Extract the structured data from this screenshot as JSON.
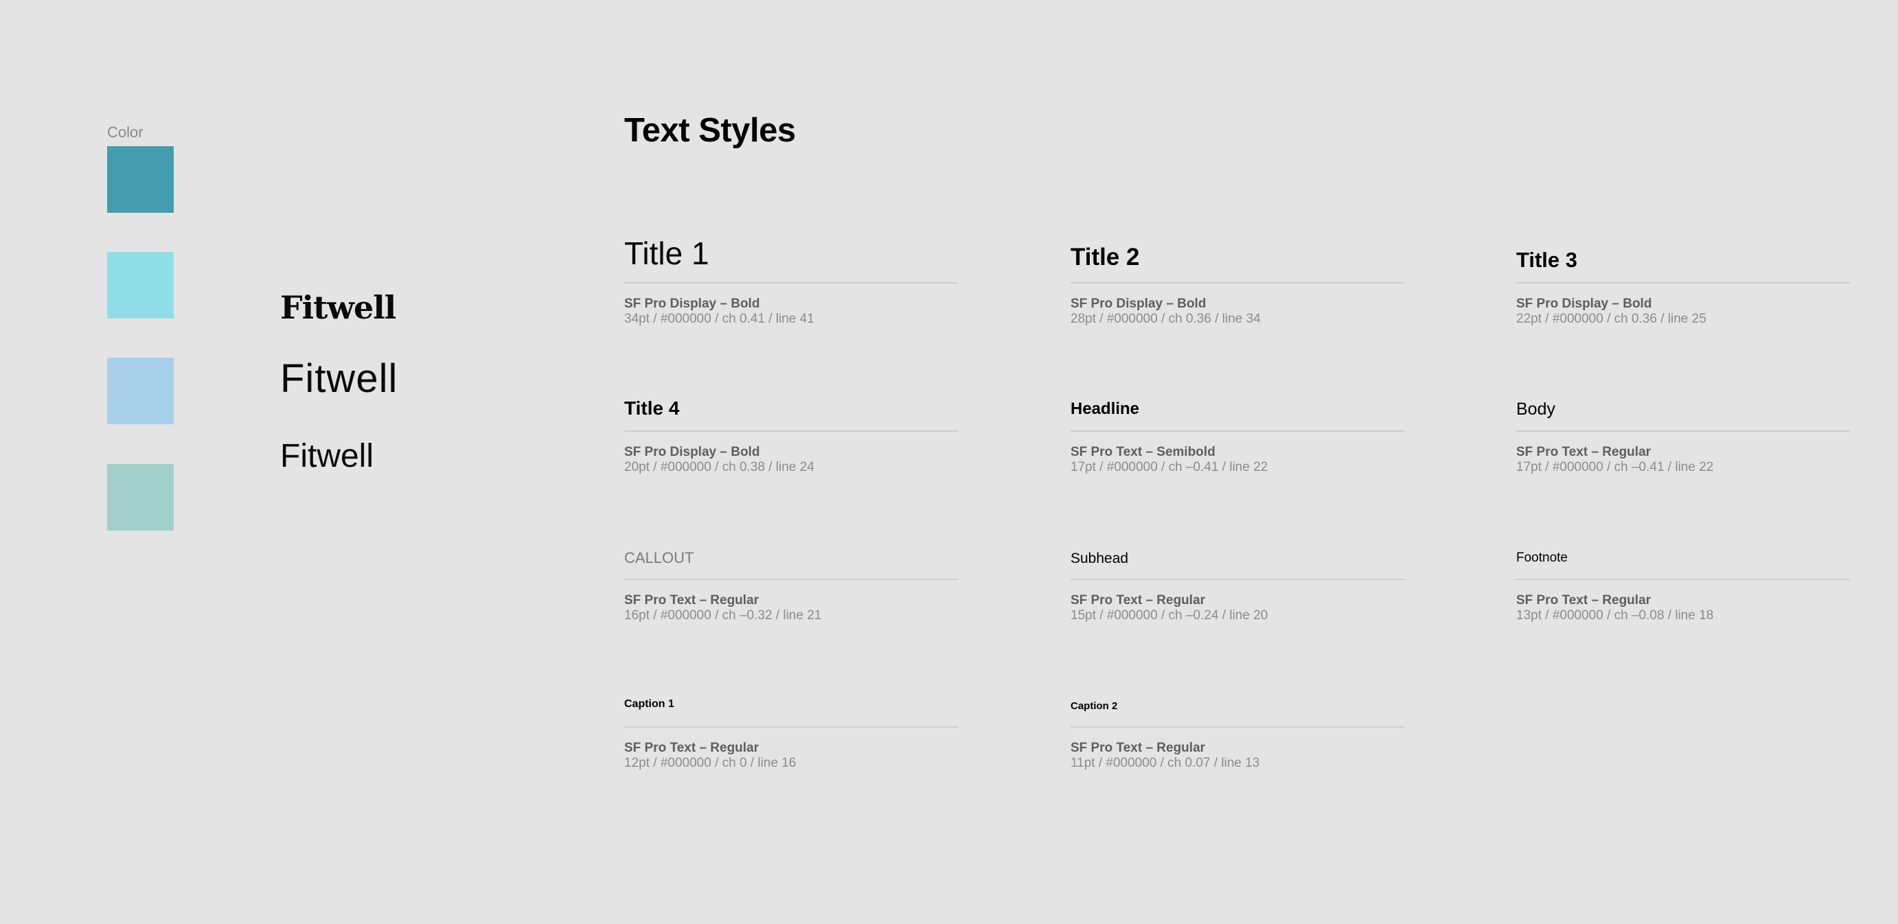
{
  "colors": {
    "label": "Color",
    "swatches": [
      "#449dae",
      "#90dfe7",
      "#a9d0ea",
      "#a3cfcb"
    ]
  },
  "logos": [
    "Fitwell",
    "Fitwell",
    "Fitwell"
  ],
  "page_title": "Text Styles",
  "styles": [
    {
      "sample": "Title 1",
      "font": "SF Pro Display – Bold",
      "detail": "34pt / #000000 / ch 0.41 / line 41"
    },
    {
      "sample": "Title 2",
      "font": "SF Pro Display – Bold",
      "detail": "28pt / #000000 / ch 0.36 / line 34"
    },
    {
      "sample": "Title 3",
      "font": "SF Pro Display – Bold",
      "detail": "22pt / #000000 / ch 0.36 / line 25"
    },
    {
      "sample": "Title 4",
      "font": "SF Pro Display – Bold",
      "detail": "20pt / #000000 / ch 0.38 / line 24"
    },
    {
      "sample": "Headline",
      "font": "SF Pro Text – Semibold",
      "detail": "17pt / #000000 / ch –0.41 / line 22"
    },
    {
      "sample": "Body",
      "font": "SF Pro Text – Regular",
      "detail": "17pt / #000000 / ch –0.41 / line 22"
    },
    {
      "sample": "CALLOUT",
      "font": "SF Pro Text – Regular",
      "detail": "16pt / #000000 / ch –0.32 / line 21"
    },
    {
      "sample": "Subhead",
      "font": "SF Pro Text – Regular",
      "detail": "15pt / #000000 / ch –0.24 / line 20"
    },
    {
      "sample": "Footnote",
      "font": "SF Pro Text – Regular",
      "detail": "13pt / #000000 / ch –0.08 / line 18"
    },
    {
      "sample": "Caption 1",
      "font": "SF Pro Text – Regular",
      "detail": "12pt / #000000 / ch 0 / line 16"
    },
    {
      "sample": "Caption 2",
      "font": "SF Pro Text – Regular",
      "detail": "11pt / #000000 / ch 0.07 / line 13"
    }
  ]
}
